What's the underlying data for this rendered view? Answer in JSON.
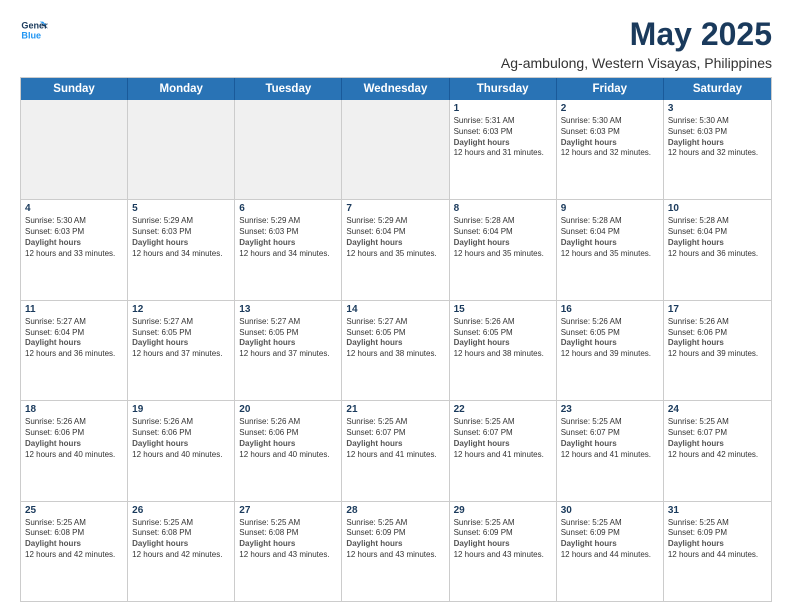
{
  "logo": {
    "line1": "General",
    "line2": "Blue"
  },
  "title": "May 2025",
  "subtitle": "Ag-ambulong, Western Visayas, Philippines",
  "headers": [
    "Sunday",
    "Monday",
    "Tuesday",
    "Wednesday",
    "Thursday",
    "Friday",
    "Saturday"
  ],
  "weeks": [
    [
      {
        "day": "",
        "sunrise": "",
        "sunset": "",
        "daylight": "",
        "shaded": true
      },
      {
        "day": "",
        "sunrise": "",
        "sunset": "",
        "daylight": "",
        "shaded": true
      },
      {
        "day": "",
        "sunrise": "",
        "sunset": "",
        "daylight": "",
        "shaded": true
      },
      {
        "day": "",
        "sunrise": "",
        "sunset": "",
        "daylight": "",
        "shaded": true
      },
      {
        "day": "1",
        "sunrise": "Sunrise: 5:31 AM",
        "sunset": "Sunset: 6:03 PM",
        "daylight": "Daylight: 12 hours and 31 minutes."
      },
      {
        "day": "2",
        "sunrise": "Sunrise: 5:30 AM",
        "sunset": "Sunset: 6:03 PM",
        "daylight": "Daylight: 12 hours and 32 minutes."
      },
      {
        "day": "3",
        "sunrise": "Sunrise: 5:30 AM",
        "sunset": "Sunset: 6:03 PM",
        "daylight": "Daylight: 12 hours and 32 minutes."
      }
    ],
    [
      {
        "day": "4",
        "sunrise": "Sunrise: 5:30 AM",
        "sunset": "Sunset: 6:03 PM",
        "daylight": "Daylight: 12 hours and 33 minutes."
      },
      {
        "day": "5",
        "sunrise": "Sunrise: 5:29 AM",
        "sunset": "Sunset: 6:03 PM",
        "daylight": "Daylight: 12 hours and 34 minutes."
      },
      {
        "day": "6",
        "sunrise": "Sunrise: 5:29 AM",
        "sunset": "Sunset: 6:03 PM",
        "daylight": "Daylight: 12 hours and 34 minutes."
      },
      {
        "day": "7",
        "sunrise": "Sunrise: 5:29 AM",
        "sunset": "Sunset: 6:04 PM",
        "daylight": "Daylight: 12 hours and 35 minutes."
      },
      {
        "day": "8",
        "sunrise": "Sunrise: 5:28 AM",
        "sunset": "Sunset: 6:04 PM",
        "daylight": "Daylight: 12 hours and 35 minutes."
      },
      {
        "day": "9",
        "sunrise": "Sunrise: 5:28 AM",
        "sunset": "Sunset: 6:04 PM",
        "daylight": "Daylight: 12 hours and 35 minutes."
      },
      {
        "day": "10",
        "sunrise": "Sunrise: 5:28 AM",
        "sunset": "Sunset: 6:04 PM",
        "daylight": "Daylight: 12 hours and 36 minutes."
      }
    ],
    [
      {
        "day": "11",
        "sunrise": "Sunrise: 5:27 AM",
        "sunset": "Sunset: 6:04 PM",
        "daylight": "Daylight: 12 hours and 36 minutes."
      },
      {
        "day": "12",
        "sunrise": "Sunrise: 5:27 AM",
        "sunset": "Sunset: 6:05 PM",
        "daylight": "Daylight: 12 hours and 37 minutes."
      },
      {
        "day": "13",
        "sunrise": "Sunrise: 5:27 AM",
        "sunset": "Sunset: 6:05 PM",
        "daylight": "Daylight: 12 hours and 37 minutes."
      },
      {
        "day": "14",
        "sunrise": "Sunrise: 5:27 AM",
        "sunset": "Sunset: 6:05 PM",
        "daylight": "Daylight: 12 hours and 38 minutes."
      },
      {
        "day": "15",
        "sunrise": "Sunrise: 5:26 AM",
        "sunset": "Sunset: 6:05 PM",
        "daylight": "Daylight: 12 hours and 38 minutes."
      },
      {
        "day": "16",
        "sunrise": "Sunrise: 5:26 AM",
        "sunset": "Sunset: 6:05 PM",
        "daylight": "Daylight: 12 hours and 39 minutes."
      },
      {
        "day": "17",
        "sunrise": "Sunrise: 5:26 AM",
        "sunset": "Sunset: 6:06 PM",
        "daylight": "Daylight: 12 hours and 39 minutes."
      }
    ],
    [
      {
        "day": "18",
        "sunrise": "Sunrise: 5:26 AM",
        "sunset": "Sunset: 6:06 PM",
        "daylight": "Daylight: 12 hours and 40 minutes."
      },
      {
        "day": "19",
        "sunrise": "Sunrise: 5:26 AM",
        "sunset": "Sunset: 6:06 PM",
        "daylight": "Daylight: 12 hours and 40 minutes."
      },
      {
        "day": "20",
        "sunrise": "Sunrise: 5:26 AM",
        "sunset": "Sunset: 6:06 PM",
        "daylight": "Daylight: 12 hours and 40 minutes."
      },
      {
        "day": "21",
        "sunrise": "Sunrise: 5:25 AM",
        "sunset": "Sunset: 6:07 PM",
        "daylight": "Daylight: 12 hours and 41 minutes."
      },
      {
        "day": "22",
        "sunrise": "Sunrise: 5:25 AM",
        "sunset": "Sunset: 6:07 PM",
        "daylight": "Daylight: 12 hours and 41 minutes."
      },
      {
        "day": "23",
        "sunrise": "Sunrise: 5:25 AM",
        "sunset": "Sunset: 6:07 PM",
        "daylight": "Daylight: 12 hours and 41 minutes."
      },
      {
        "day": "24",
        "sunrise": "Sunrise: 5:25 AM",
        "sunset": "Sunset: 6:07 PM",
        "daylight": "Daylight: 12 hours and 42 minutes."
      }
    ],
    [
      {
        "day": "25",
        "sunrise": "Sunrise: 5:25 AM",
        "sunset": "Sunset: 6:08 PM",
        "daylight": "Daylight: 12 hours and 42 minutes."
      },
      {
        "day": "26",
        "sunrise": "Sunrise: 5:25 AM",
        "sunset": "Sunset: 6:08 PM",
        "daylight": "Daylight: 12 hours and 42 minutes."
      },
      {
        "day": "27",
        "sunrise": "Sunrise: 5:25 AM",
        "sunset": "Sunset: 6:08 PM",
        "daylight": "Daylight: 12 hours and 43 minutes."
      },
      {
        "day": "28",
        "sunrise": "Sunrise: 5:25 AM",
        "sunset": "Sunset: 6:09 PM",
        "daylight": "Daylight: 12 hours and 43 minutes."
      },
      {
        "day": "29",
        "sunrise": "Sunrise: 5:25 AM",
        "sunset": "Sunset: 6:09 PM",
        "daylight": "Daylight: 12 hours and 43 minutes."
      },
      {
        "day": "30",
        "sunrise": "Sunrise: 5:25 AM",
        "sunset": "Sunset: 6:09 PM",
        "daylight": "Daylight: 12 hours and 44 minutes."
      },
      {
        "day": "31",
        "sunrise": "Sunrise: 5:25 AM",
        "sunset": "Sunset: 6:09 PM",
        "daylight": "Daylight: 12 hours and 44 minutes."
      }
    ]
  ]
}
